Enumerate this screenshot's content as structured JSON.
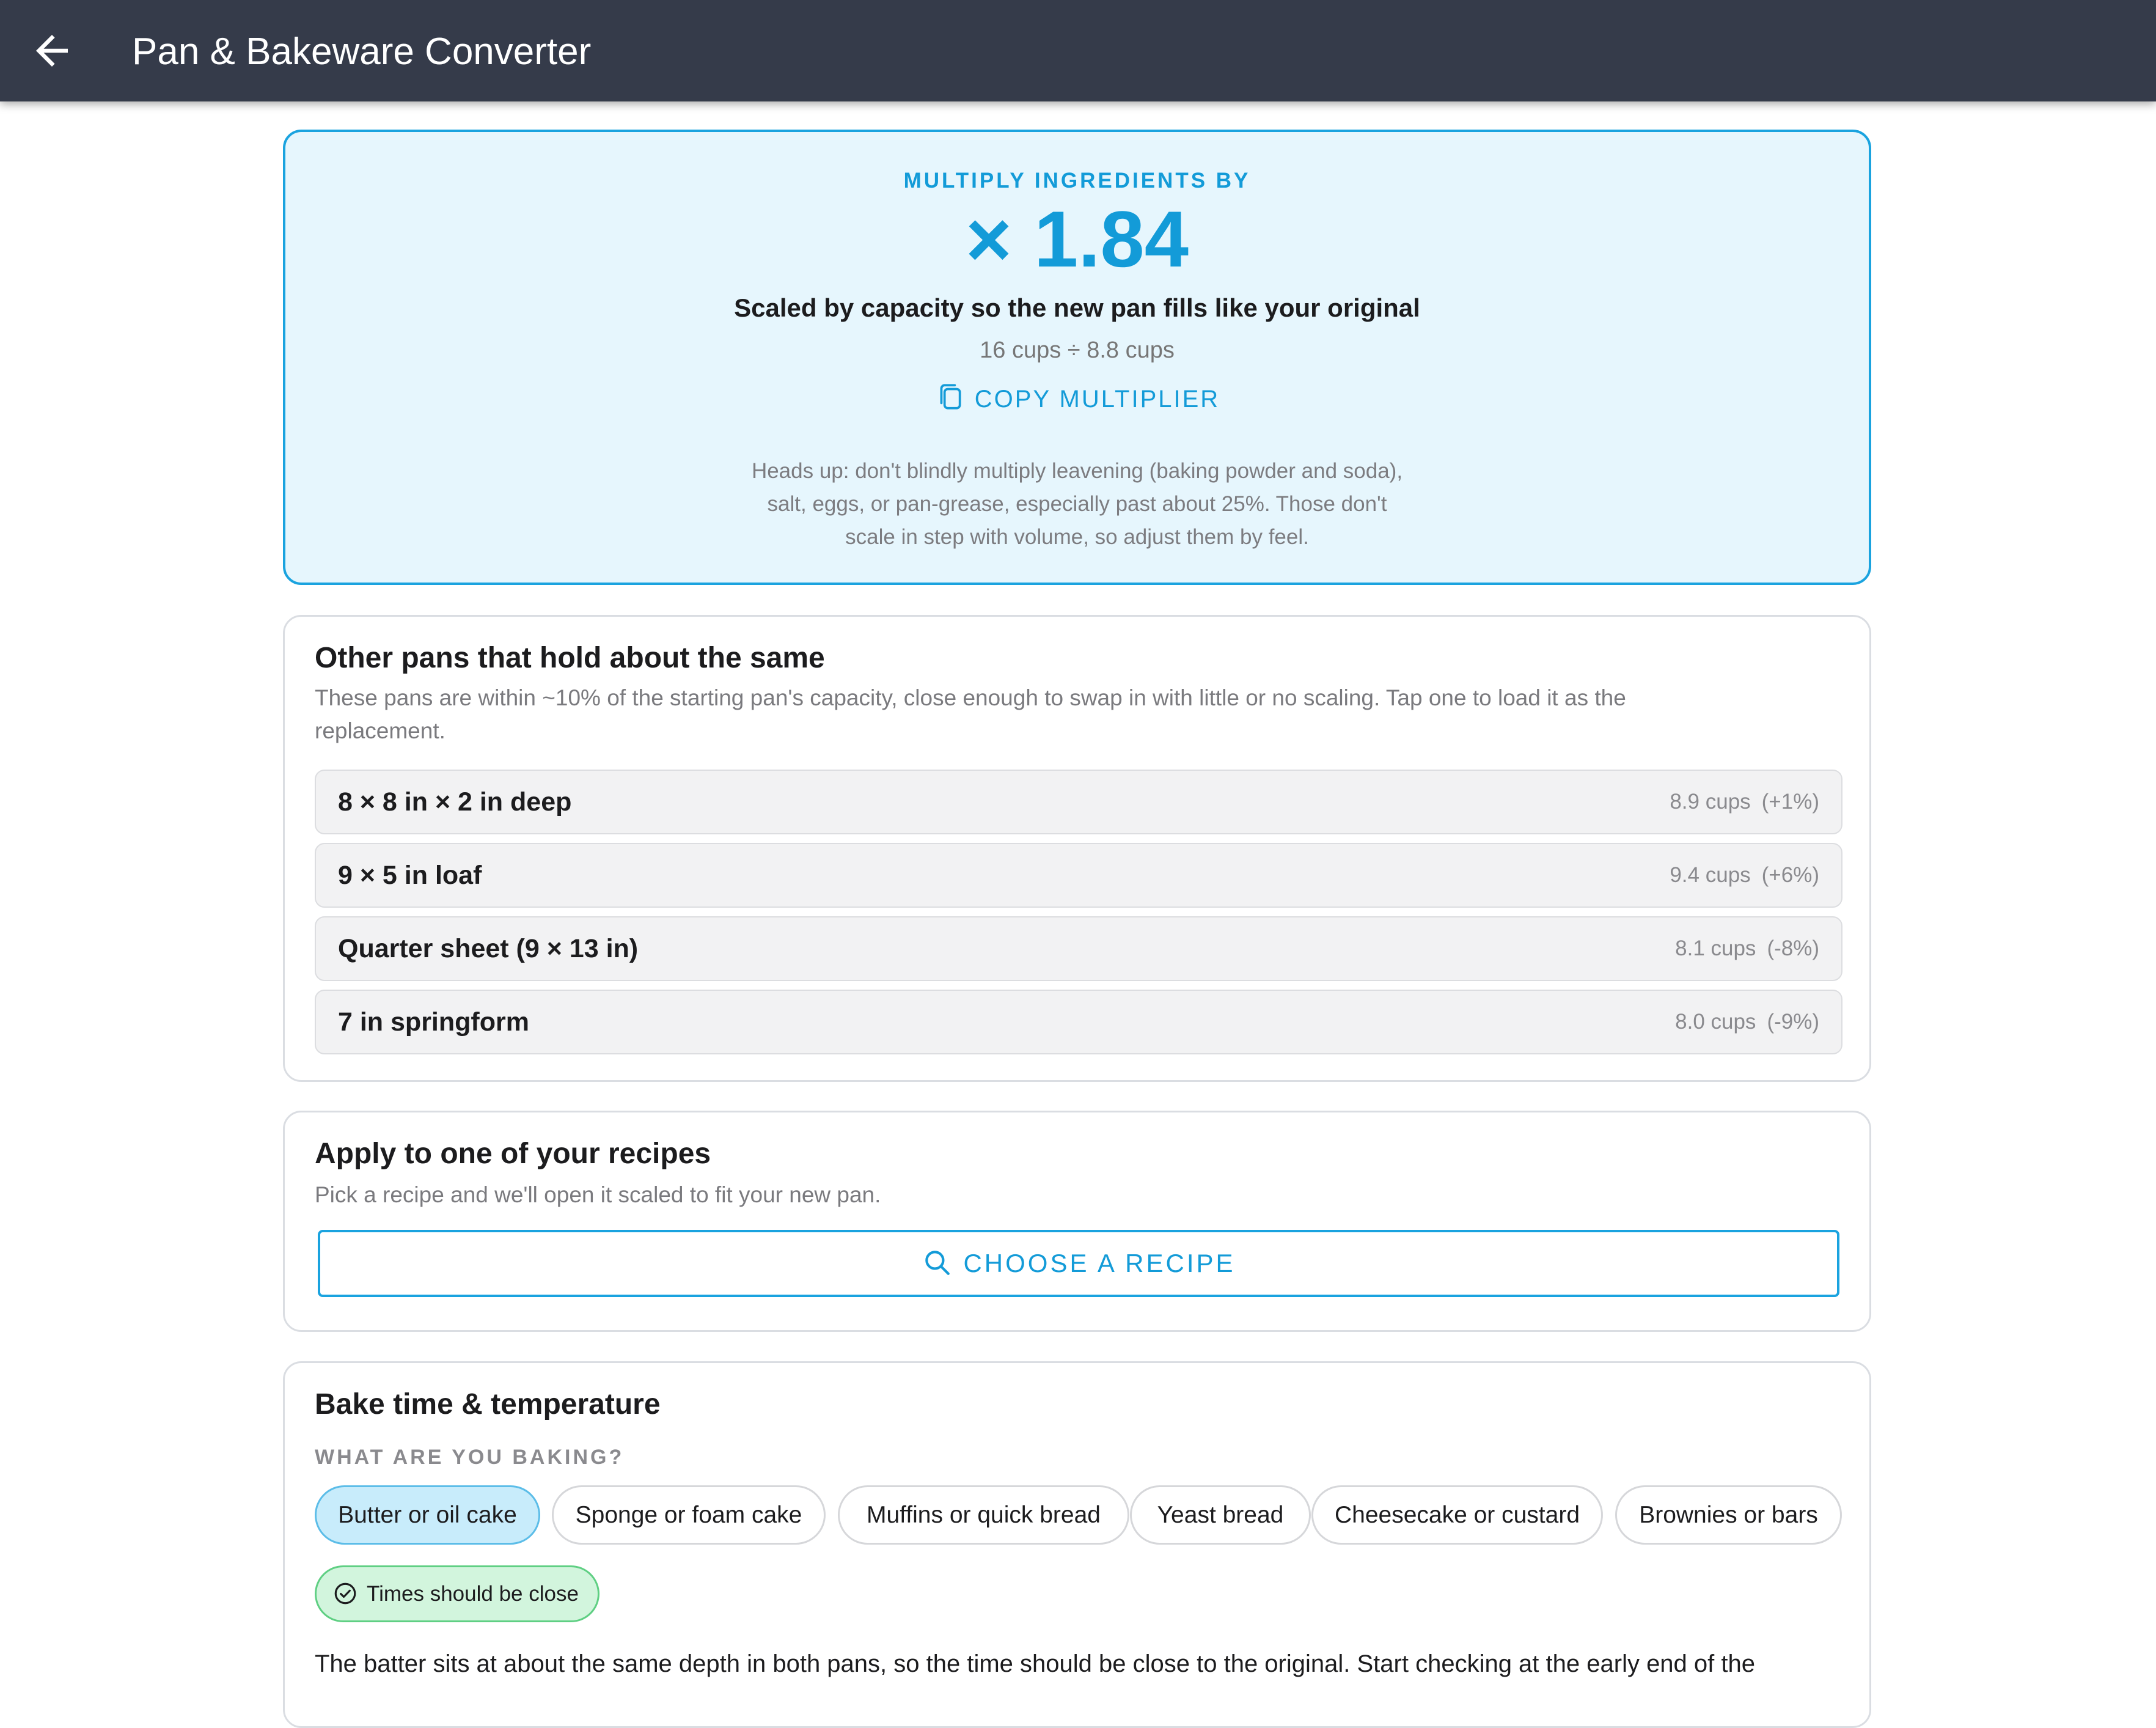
{
  "app": {
    "title": "Pan & Bakeware Converter"
  },
  "hero": {
    "label": "MULTIPLY INGREDIENTS BY",
    "multiplier": "× 1.84",
    "subtitle": "Scaled by capacity so the new pan fills like your original",
    "formula": "16 cups ÷ 8.8 cups",
    "copy_label": "COPY MULTIPLIER",
    "note_lines": [
      "Heads up: don't blindly multiply leavening (baking powder and soda),",
      "salt, eggs, or pan-grease, especially past about 25%. Those don't",
      "scale in step with volume, so adjust them by feel."
    ]
  },
  "similar_pans": {
    "title": "Other pans that hold about the same",
    "description_lines": [
      "These pans are within ~10% of the starting pan's capacity, close enough to swap in with little or no scaling. Tap one to load it as the",
      "replacement."
    ],
    "items": [
      {
        "name": "8 × 8 in × 2 in deep",
        "cups": "8.9 cups",
        "diff": "(+1%)"
      },
      {
        "name": "9 × 5 in loaf",
        "cups": "9.4 cups",
        "diff": "(+6%)"
      },
      {
        "name": "Quarter sheet (9 × 13 in)",
        "cups": "8.1 cups",
        "diff": "(-8%)"
      },
      {
        "name": "7 in springform",
        "cups": "8.0 cups",
        "diff": "(-9%)"
      }
    ]
  },
  "apply": {
    "title": "Apply to one of your recipes",
    "description": "Pick a recipe and we'll open it scaled to fit your new pan.",
    "button_label": "CHOOSE A RECIPE"
  },
  "bake": {
    "title": "Bake time & temperature",
    "subtitle": "WHAT ARE YOU BAKING?",
    "options": [
      {
        "label": "Butter or oil cake",
        "selected": true
      },
      {
        "label": "Sponge or foam cake",
        "selected": false
      },
      {
        "label": "Muffins or quick bread",
        "selected": false
      },
      {
        "label": "Yeast bread",
        "selected": false
      },
      {
        "label": "Cheesecake or custard",
        "selected": false
      },
      {
        "label": "Brownies or bars",
        "selected": false
      }
    ],
    "status": "Times should be close",
    "description": "The batter sits at about the same depth in both pans, so the time should be close to the original. Start checking at the early end of the"
  },
  "colors": {
    "header_bg": "#353b4a",
    "accent": "#139bd8",
    "hero_bg": "#e6f6fd",
    "chip_selected_bg": "#c8ecfb",
    "status_bg": "#d2f5dd",
    "status_border": "#5fcf83"
  },
  "icons": {
    "back": "arrow-left-icon",
    "copy": "copy-icon",
    "search": "search-icon",
    "status": "check-circle-icon"
  }
}
